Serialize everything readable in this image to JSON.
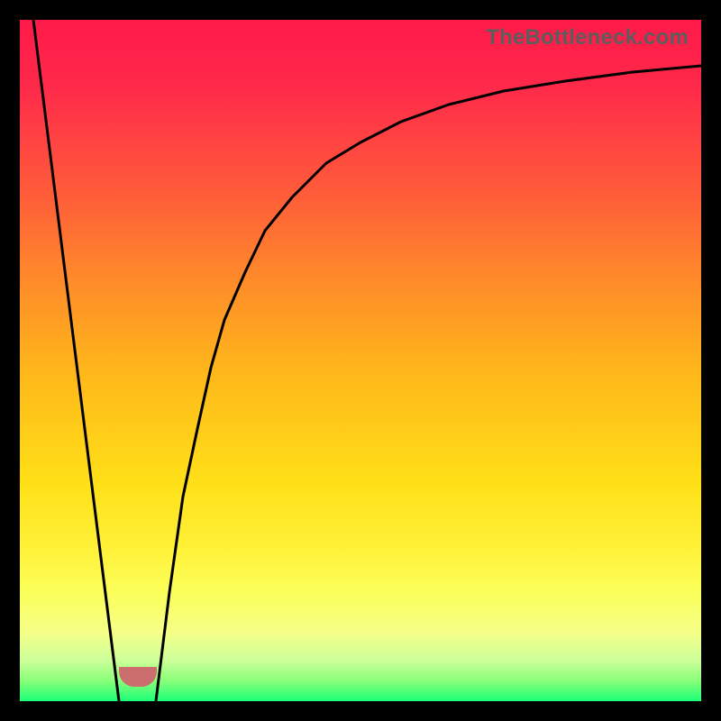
{
  "watermark": "TheBottleneck.com",
  "colors": {
    "frame": "#000000",
    "watermark": "#5d5d5d",
    "curve": "#000000",
    "bump": "#cc6e6e"
  },
  "chart_data": {
    "type": "line",
    "title": "",
    "xlabel": "",
    "ylabel": "",
    "xlim": [
      0,
      100
    ],
    "ylim": [
      0,
      100
    ],
    "grid": false,
    "series": [
      {
        "name": "left-segment",
        "x": [
          2,
          14.5
        ],
        "y": [
          100,
          0
        ]
      },
      {
        "name": "right-curve",
        "x": [
          20,
          22,
          24,
          26,
          28,
          30,
          33,
          36,
          40,
          45,
          50,
          56,
          63,
          71,
          80,
          90,
          100
        ],
        "y": [
          0,
          16,
          30,
          40,
          49,
          56,
          63,
          69,
          74,
          79,
          82,
          85,
          87.5,
          89.5,
          91,
          92.3,
          93.3
        ]
      }
    ],
    "annotations": [
      {
        "name": "bottom-bump",
        "x": 14.5,
        "y": 2.5
      }
    ]
  }
}
